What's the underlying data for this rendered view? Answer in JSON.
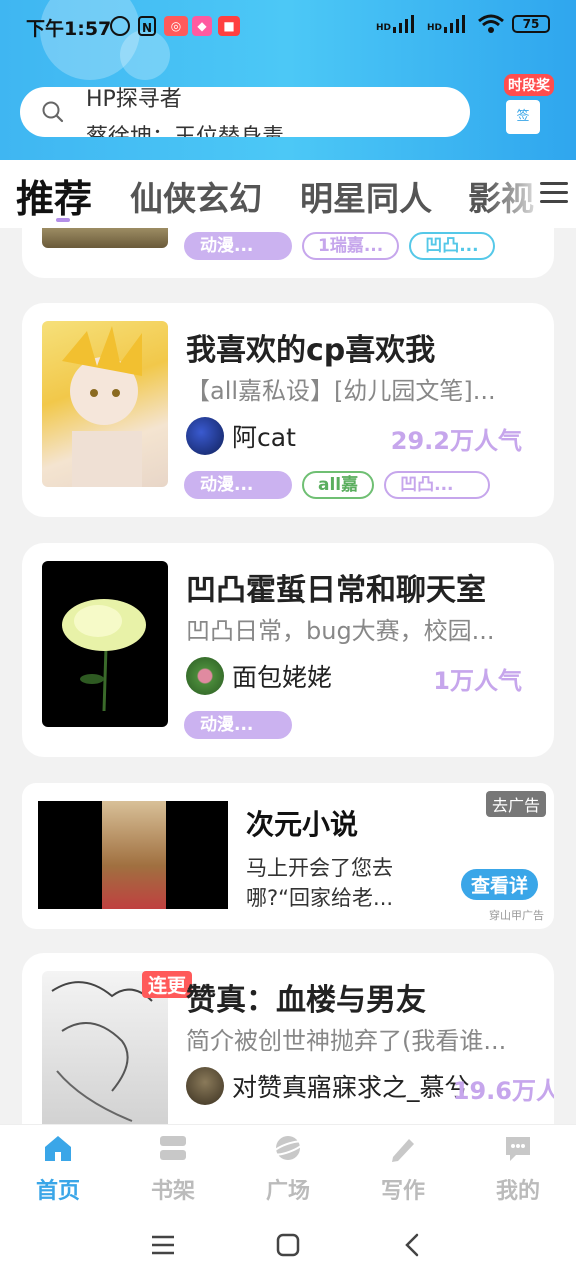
{
  "status_bar": {
    "time": "下午1:57",
    "signal1": "HD",
    "signal2": "HD",
    "battery": "75",
    "app_icons": [
      "alarm-icon",
      "nfc-icon",
      "app-icon-1",
      "app-icon-2",
      "app-icon-3"
    ]
  },
  "header": {
    "search_line1": "HP探寻者",
    "search_line2": "蔡徐坤：王位替身毒",
    "checkin_tag": "时段奖",
    "checkin_box": "签"
  },
  "tabs": [
    "推荐",
    "仙侠玄幻",
    "明星同人",
    "影视"
  ],
  "cards": [
    {
      "tags": [
        {
          "label": "动漫...",
          "style": "purple"
        },
        {
          "label": "1瑞嘉...",
          "style": "outline-purple"
        },
        {
          "label": "凹凸...",
          "style": "outline-cyan"
        }
      ]
    },
    {
      "title": "我喜欢的cp喜欢我",
      "desc": "【all嘉私设】[幼儿园文笔]...",
      "author": "阿cat",
      "popularity": "29.2万人气",
      "tags": [
        {
          "label": "动漫...",
          "style": "purple"
        },
        {
          "label": "all嘉",
          "style": "outline-green"
        },
        {
          "label": "凹凸...",
          "style": "outline-purple"
        }
      ]
    },
    {
      "title": "凹凸霍蜇日常和聊天室",
      "desc": "凹凸日常，bug大赛，校园...",
      "author": "面包姥姥",
      "popularity": "1万人气",
      "tags": [
        {
          "label": "动漫...",
          "style": "purple"
        }
      ]
    },
    {
      "title": "赞真：血楼与男友",
      "desc": "简介被创世神抛弃了(我看谁...",
      "author": "对赞真寤寐求之_慕兮",
      "popularity": "19.6万人",
      "badge": "连更"
    }
  ],
  "ad": {
    "title": "次元小说",
    "desc": "马上开会了您去哪?“回家给老...",
    "close_label": "去广告",
    "button_label": "查看详",
    "source": "穿山甲广告"
  },
  "bottom_nav": [
    {
      "label": "首页",
      "icon": "home-icon",
      "active": true
    },
    {
      "label": "书架",
      "icon": "bookshelf-icon",
      "active": false
    },
    {
      "label": "广场",
      "icon": "planet-icon",
      "active": false
    },
    {
      "label": "写作",
      "icon": "pen-icon",
      "active": false
    },
    {
      "label": "我的",
      "icon": "chat-icon",
      "active": false
    }
  ],
  "colors": {
    "header_blue": "#3fb6f2",
    "accent_blue": "#3aa6e8",
    "popularity_purple": "#c6a6ec",
    "tag_purple": "#cbb2f0",
    "badge_red": "#ff5a5a"
  }
}
